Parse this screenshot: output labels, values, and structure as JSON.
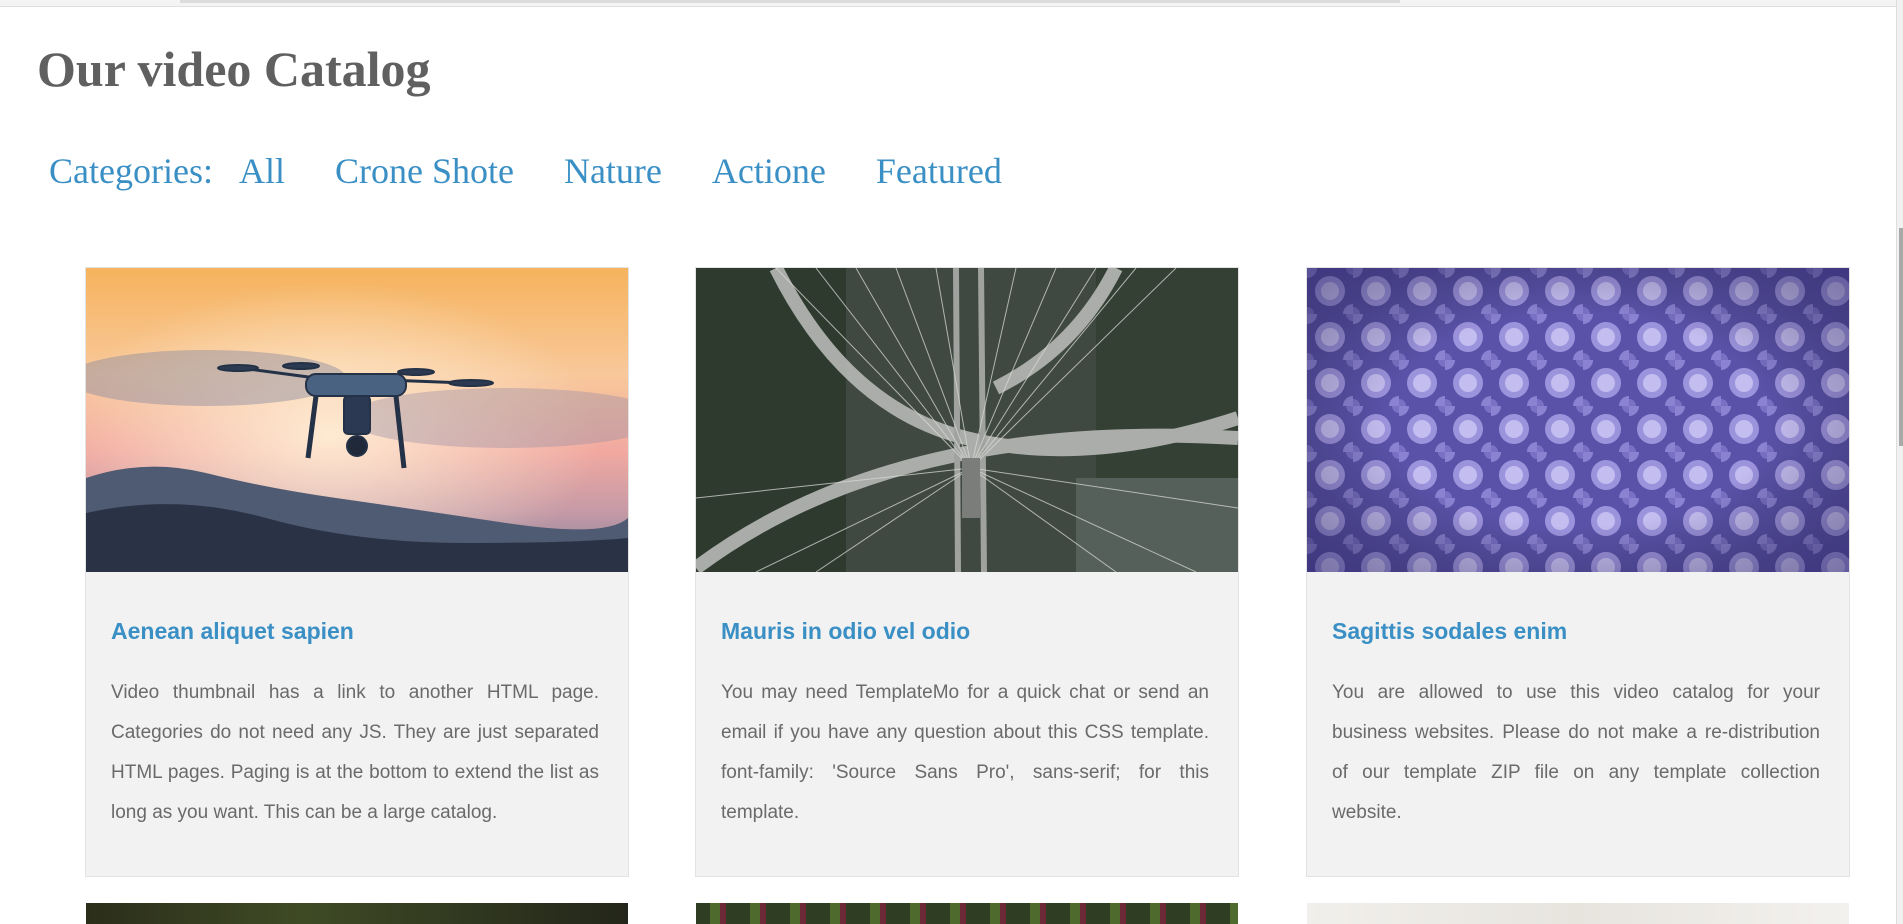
{
  "page": {
    "title": "Our video Catalog"
  },
  "categories": {
    "label": "Categories:",
    "items": [
      "All",
      "Crone Shote",
      "Nature",
      "Actione",
      "Featured"
    ]
  },
  "videos": [
    {
      "title": "Aenean aliquet sapien",
      "description": "Video thumbnail has a link to another HTML page. Categories do not need any JS. They are just separated HTML pages. Paging is at the bottom to extend the list as long as you want. This can be a large catalog.",
      "thumbnail": "drone-at-sunset-thumbnail"
    },
    {
      "title": "Mauris in odio vel odio",
      "description": "You may need TemplateMo for a quick chat or send an email if you have any question about this CSS template. font-family: 'Source Sans Pro', sans-serif; for this template.",
      "thumbnail": "cable-stayed-bridge-aerial-thumbnail"
    },
    {
      "title": "Sagittis sodales enim",
      "description": "You are allowed to use this video catalog for your business websites. Please do not make a re-distribution of our template ZIP file on any template collection website.",
      "thumbnail": "purple-forest-aerial-thumbnail"
    }
  ],
  "colors": {
    "link_blue": "#3a8fc5",
    "title_gray": "#606060",
    "text_gray": "#6a6a6a",
    "card_bg": "#f2f2f2"
  }
}
